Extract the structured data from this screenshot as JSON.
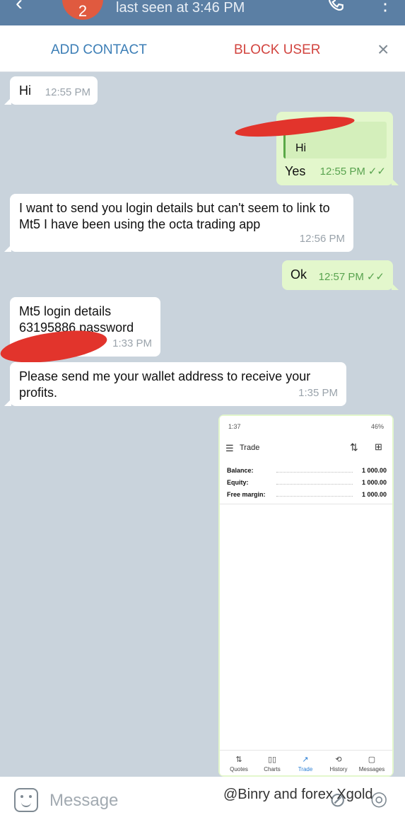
{
  "header": {
    "back_icon": "back-arrow-icon",
    "avatar_initial": "2",
    "status": "last seen at 3:46 PM",
    "call_icon": "phone-icon",
    "more_icon": "more-vertical-icon"
  },
  "actions": {
    "add_contact": "ADD CONTACT",
    "block_user": "BLOCK USER",
    "close": "×"
  },
  "messages": [
    {
      "direction": "in",
      "text": "Hi",
      "time": "12:55 PM"
    },
    {
      "direction": "out",
      "reply_quote": "Hi",
      "text": "Yes",
      "time": "12:55 PM",
      "status": "read"
    },
    {
      "direction": "in",
      "text": "I want to send you login details but can't seem to link to Mt5 I have been using the octa trading app",
      "time": "12:56 PM"
    },
    {
      "direction": "out",
      "text": "Ok",
      "time": "12:57 PM",
      "status": "read"
    },
    {
      "direction": "in",
      "text": "Mt5 login details 63195886 password",
      "time": "1:33 PM"
    },
    {
      "direction": "in",
      "text": "Please send me your wallet address to receive your profits.",
      "time": "1:35 PM"
    }
  ],
  "screenshot": {
    "status_time": "1:37",
    "battery": "46%",
    "title": "Trade",
    "rows": [
      {
        "label": "Balance:",
        "value": "1 000.00"
      },
      {
        "label": "Equity:",
        "value": "1 000.00"
      },
      {
        "label": "Free margin:",
        "value": "1 000.00"
      }
    ],
    "nav": [
      {
        "label": "Quotes",
        "icon": "⇅",
        "active": false
      },
      {
        "label": "Charts",
        "icon": "▯▯",
        "active": false
      },
      {
        "label": "Trade",
        "icon": "↗",
        "active": true
      },
      {
        "label": "History",
        "icon": "⟲",
        "active": false
      },
      {
        "label": "Messages",
        "icon": "▢",
        "active": false
      }
    ]
  },
  "input": {
    "placeholder": "Message",
    "emoji_icon": "emoji-icon",
    "attach_icon": "attach-icon",
    "mic_icon": "mic-icon"
  },
  "watermark": "@Binry and forex Xgold",
  "colors": {
    "header_bg": "#5b7fa4",
    "chat_bg": "#c9d3dc",
    "outgoing_bubble": "#e3f7cc",
    "add_contact": "#3c7eb6",
    "block_user": "#d2443f",
    "redaction": "#e2342c"
  }
}
